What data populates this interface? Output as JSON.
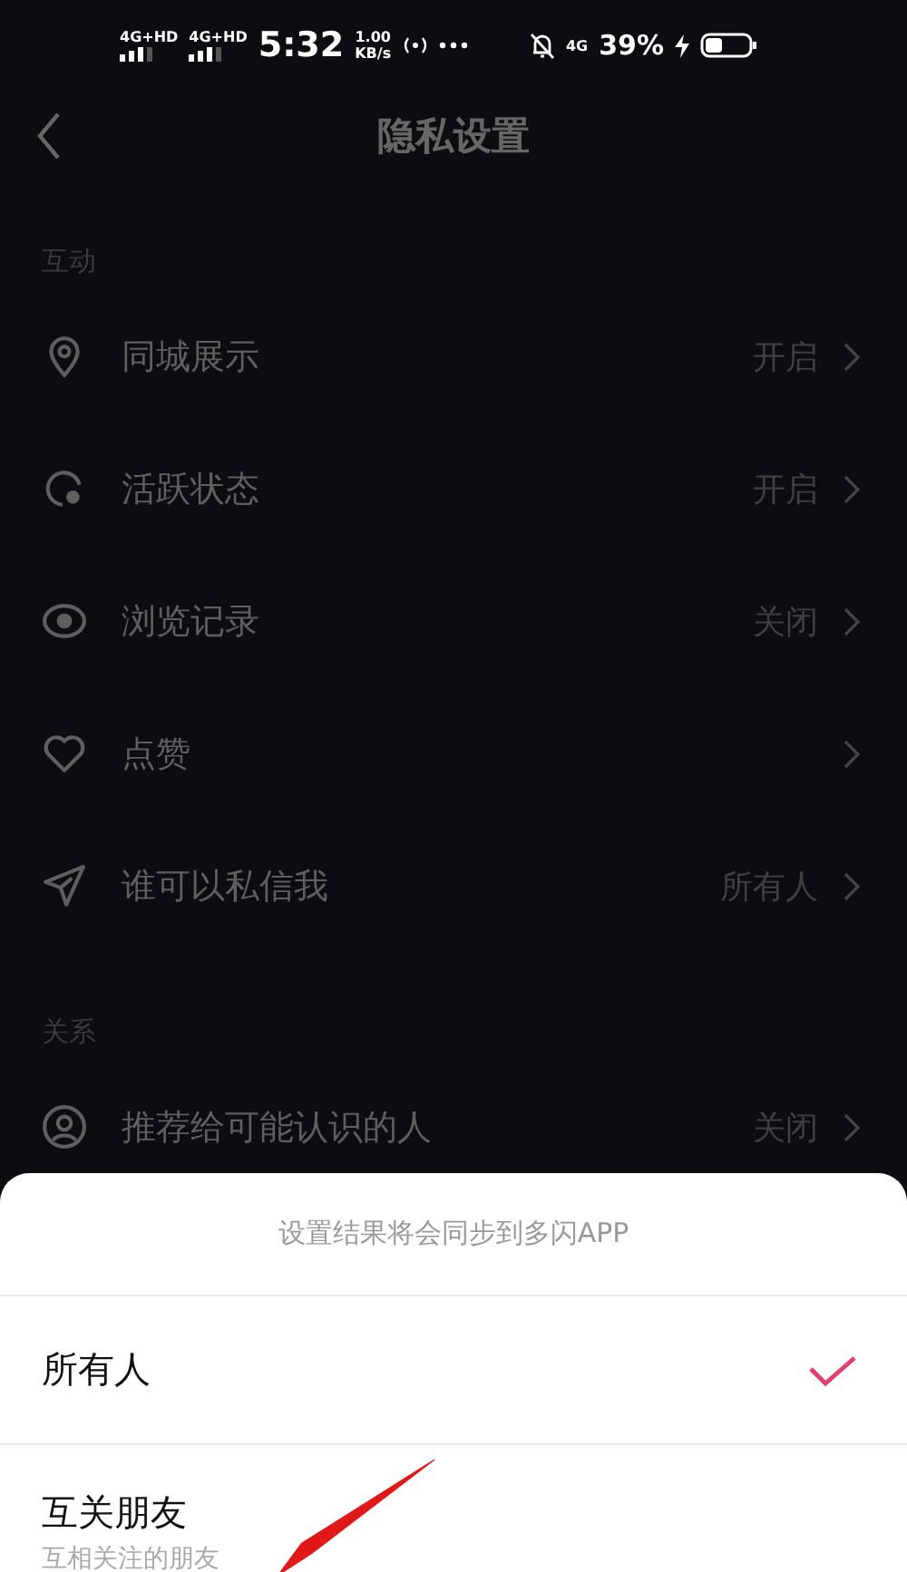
{
  "status_bar": {
    "sim_1": "4G+HD",
    "sim_2": "4G+HD",
    "time": "5:32",
    "speed_value": "1.00",
    "speed_unit": "KB/s",
    "network": "4G",
    "battery": "39%"
  },
  "header": {
    "title": "隐私设置"
  },
  "sections": [
    {
      "title": "互动",
      "rows": [
        {
          "kind": "pin",
          "label": "同城展示",
          "value": "开启"
        },
        {
          "kind": "active",
          "label": "活跃状态",
          "value": "开启"
        },
        {
          "kind": "eye",
          "label": "浏览记录",
          "value": "关闭"
        },
        {
          "kind": "heart",
          "label": "点赞"
        },
        {
          "kind": "send",
          "label": "谁可以私信我",
          "value": "所有人"
        }
      ]
    },
    {
      "title": "关系",
      "rows": [
        {
          "kind": "person",
          "label": "推荐给可能认识的人",
          "value": "关闭"
        }
      ]
    }
  ],
  "sheet": {
    "notice": "设置结果将会同步到多闪APP",
    "options": [
      {
        "label": "所有人",
        "selected": true
      },
      {
        "label": "互关朋友",
        "description": "互相关注的朋友",
        "selected": false
      }
    ]
  }
}
